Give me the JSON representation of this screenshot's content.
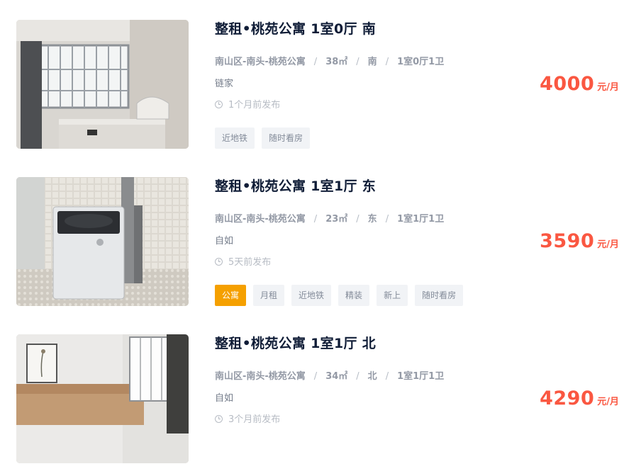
{
  "listings": [
    {
      "title": "整租•桃苑公寓 1室0厅 南",
      "location": "南山区-南头-桃苑公寓",
      "area": "38㎡",
      "orientation": "南",
      "layout": "1室0厅1卫",
      "brand": "链家",
      "posted": "1个月前发布",
      "tags": [
        "近地铁",
        "随时看房"
      ],
      "highlight_tag": "",
      "price": "4000",
      "unit": "元/月",
      "image_alt": "bedroom-photo"
    },
    {
      "title": "整租•桃苑公寓 1室1厅 东",
      "location": "南山区-南头-桃苑公寓",
      "area": "23㎡",
      "orientation": "东",
      "layout": "1室1厅1卫",
      "brand": "自如",
      "posted": "5天前发布",
      "tags": [
        "月租",
        "近地铁",
        "精装",
        "新上",
        "随时看房"
      ],
      "highlight_tag": "公寓",
      "price": "3590",
      "unit": "元/月",
      "image_alt": "washing-machine-photo"
    },
    {
      "title": "整租•桃苑公寓 1室1厅 北",
      "location": "南山区-南头-桃苑公寓",
      "area": "34㎡",
      "orientation": "北",
      "layout": "1室1厅1卫",
      "brand": "自如",
      "posted": "3个月前发布",
      "tags": [],
      "highlight_tag": "",
      "price": "4290",
      "unit": "元/月",
      "image_alt": "bedroom-photo"
    }
  ],
  "separator": "/",
  "colors": {
    "price": "#fa5741",
    "title": "#101d37",
    "highlight_tag": "#f5a000"
  }
}
